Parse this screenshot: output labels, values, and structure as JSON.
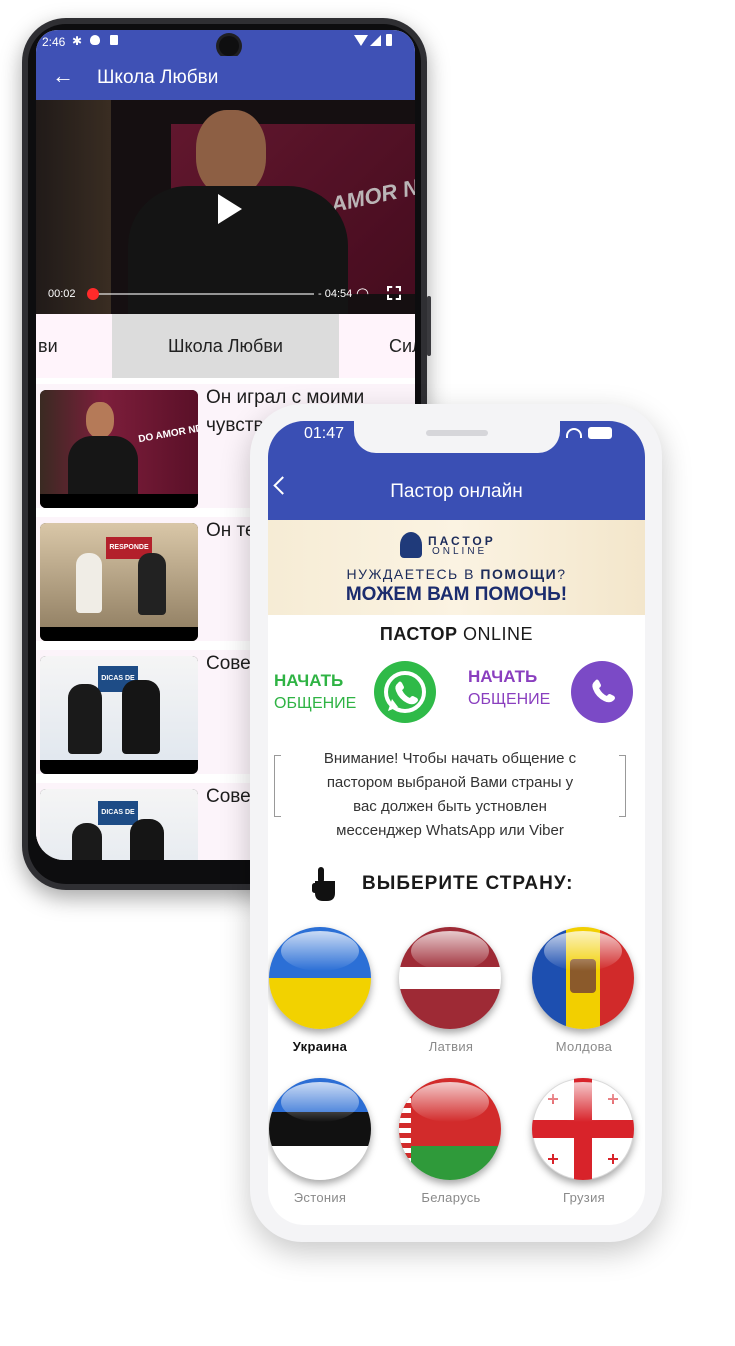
{
  "android": {
    "status": {
      "time": "2:46"
    },
    "appbar": {
      "title": "Школа Любви"
    },
    "video": {
      "overlay_text": "DO AMOR NDE",
      "current_time": "00:02",
      "remaining_time": "- 04:54",
      "progress": 0.02
    },
    "tabs": [
      {
        "label": "ви"
      },
      {
        "label": "Школа Любви",
        "selected": true
      },
      {
        "label": "Сил"
      }
    ],
    "videos": [
      {
        "title": "Он играл с моими чувств",
        "thumb_text": "DO AMOR NDE"
      },
      {
        "title": "Он те этого",
        "thumb_text": "RESPONDE"
      },
      {
        "title": "Сове",
        "thumb_text": "DICAS DE AMOR"
      },
      {
        "title": "Сове",
        "thumb_text": "DICAS DE AMOR"
      }
    ]
  },
  "iphone": {
    "status": {
      "time": "01:47"
    },
    "appbar": {
      "title": "Пастор онлайн"
    },
    "banner": {
      "logo_line1": "ПАСТОР",
      "logo_line2": "ONLINE",
      "need_prefix": "НУЖДАЕТЕСЬ В ",
      "need_bold": "ПОМОЩИ",
      "need_suffix": "?",
      "headline": "МОЖЕМ ВАМ ПОМОЧЬ!"
    },
    "brand": {
      "bold": "ПАСТОР",
      "light": "ONLINE"
    },
    "whatsapp": {
      "line1": "НАЧАТЬ",
      "line2": "ОБЩЕНИЕ",
      "color": "#2fb344"
    },
    "viber": {
      "line1": "НАЧАТЬ",
      "line2": "ОБЩЕНИЕ",
      "color": "#8a3fbf"
    },
    "notice": [
      "Внимание! Чтобы начать общение с",
      "пастором выбраной Вами страны у",
      "вас должен быть устновлен",
      "мессенджер WhatsApp или Viber"
    ],
    "choose_country": "ВЫБЕРИТЕ СТРАНУ:",
    "countries": [
      {
        "name": "Украина",
        "selected": true
      },
      {
        "name": "Латвия"
      },
      {
        "name": "Молдова"
      },
      {
        "name": "Эстония"
      },
      {
        "name": "Беларусь"
      },
      {
        "name": "Грузия"
      }
    ]
  },
  "colors": {
    "android_primary": "#3f51b5",
    "ios_primary": "#3a4fb4"
  }
}
